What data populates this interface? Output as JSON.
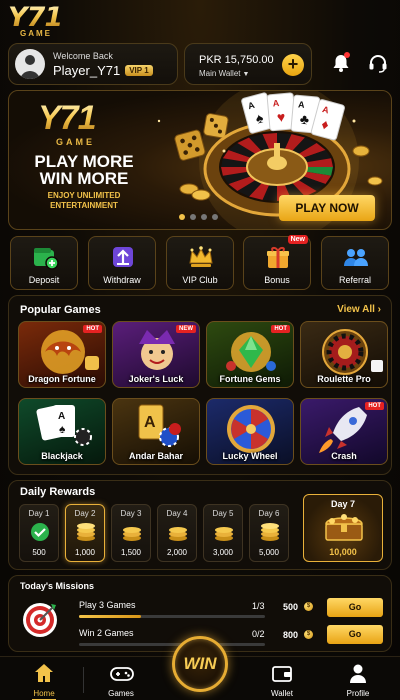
{
  "brand": {
    "logo": "Y71",
    "logo_sub": "GAME"
  },
  "user": {
    "welcome": "Welcome Back",
    "name": "Player_Y71",
    "vip": "VIP 1"
  },
  "wallet": {
    "amount": "PKR 15,750.00",
    "label": "Main Wallet",
    "add": "+"
  },
  "banner": {
    "logo": "Y71",
    "logo_sub": "GAME",
    "headline_1": "PLAY MORE",
    "headline_2": "WIN MORE",
    "tag_1": "ENJOY UNLIMITED",
    "tag_2": "ENTERTAINMENT",
    "cta": "PLAY NOW",
    "slides": 4,
    "active_slide": 1
  },
  "actions": [
    {
      "label": "Deposit",
      "icon": "wallet-plus-icon"
    },
    {
      "label": "Withdraw",
      "icon": "withdraw-arrow-icon"
    },
    {
      "label": "VIP Club",
      "icon": "crown-icon"
    },
    {
      "label": "Bonus",
      "icon": "gift-icon",
      "tag": "New"
    },
    {
      "label": "Referral",
      "icon": "users-icon"
    }
  ],
  "popular": {
    "title": "Popular Games",
    "view_all": "View All",
    "games": [
      {
        "name": "Dragon Fortune",
        "tag": "HOT"
      },
      {
        "name": "Joker's Luck",
        "tag": "NEW"
      },
      {
        "name": "Fortune Gems",
        "tag": "HOT"
      },
      {
        "name": "Roulette Pro",
        "tag": ""
      },
      {
        "name": "Blackjack",
        "tag": ""
      },
      {
        "name": "Andar Bahar",
        "tag": ""
      },
      {
        "name": "Lucky Wheel",
        "tag": ""
      },
      {
        "name": "Crash",
        "tag": "HOT"
      }
    ]
  },
  "rewards": {
    "title": "Daily Rewards",
    "days": [
      {
        "label": "Day 1",
        "amount": "500",
        "state": "claimed"
      },
      {
        "label": "Day 2",
        "amount": "1,000",
        "state": "active"
      },
      {
        "label": "Day 3",
        "amount": "1,500",
        "state": "locked"
      },
      {
        "label": "Day 4",
        "amount": "2,000",
        "state": "locked"
      },
      {
        "label": "Day 5",
        "amount": "3,000",
        "state": "locked"
      },
      {
        "label": "Day 6",
        "amount": "5,000",
        "state": "locked"
      }
    ],
    "day7": {
      "label": "Day 7",
      "amount": "10,000"
    }
  },
  "missions": {
    "title": "Today's Missions",
    "items": [
      {
        "name": "Play 3 Games",
        "progress": "1/3",
        "reward": "500",
        "action": "Go",
        "fraction": 0.333
      },
      {
        "name": "Win 2 Games",
        "progress": "0/2",
        "reward": "800",
        "action": "Go",
        "fraction": 0
      }
    ]
  },
  "nav": {
    "home": "Home",
    "games": "Games",
    "win": "WIN",
    "wallet": "Wallet",
    "profile": "Profile",
    "active": "home"
  },
  "colors": {
    "accent": "#f2c24a",
    "background": "#0d0a06",
    "hot": "#e52222"
  }
}
